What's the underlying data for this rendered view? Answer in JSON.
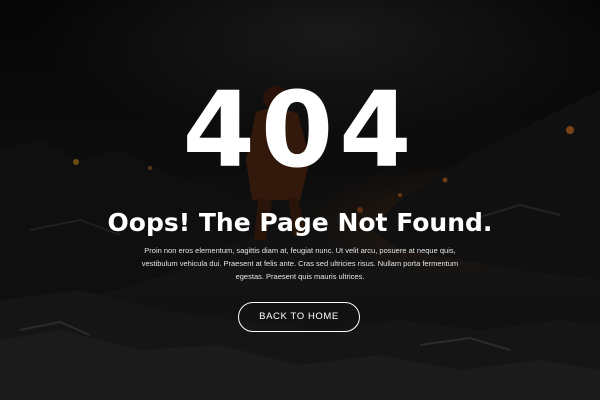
{
  "hero": {
    "error_code": "404",
    "headline": "Oops! The Page Not Found.",
    "description": "Proin non eros elementum, sagittis diam at, feugiat nunc. Ut velit arcu, posuere at neque quis, vestibulum vehicula dui. Praesent at felis ante. Cras sed ultricies risus. Nullam porta fermentum egestas. Praesent quis mauris ultrices.",
    "back_button_label": "BACK TO HOME"
  },
  "colors": {
    "background": "#0b0b0b",
    "text": "#ffffff",
    "accent_orange": "#c86a1e"
  }
}
